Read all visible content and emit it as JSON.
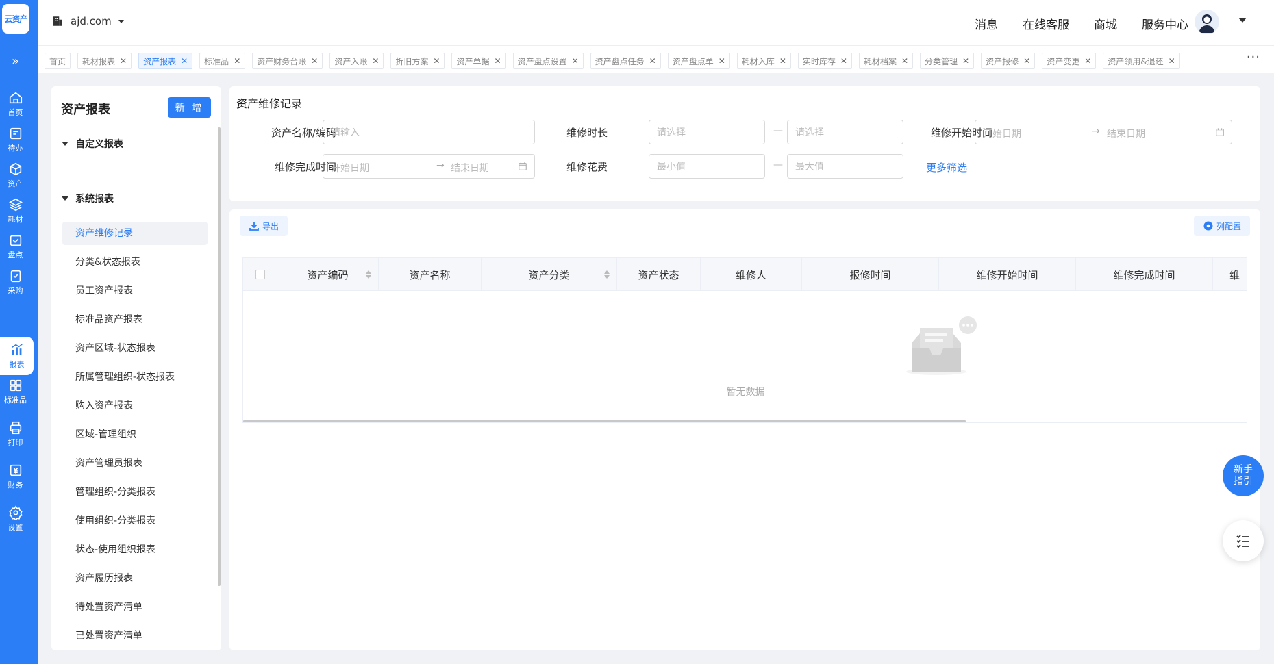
{
  "app": {
    "logo_text": "云资产"
  },
  "nav": {
    "items": [
      {
        "label": "首页",
        "icon": "home-icon"
      },
      {
        "label": "待办",
        "icon": "todo-icon"
      },
      {
        "label": "资产",
        "icon": "asset-box-icon"
      },
      {
        "label": "耗材",
        "icon": "layers-icon"
      },
      {
        "label": "盘点",
        "icon": "check-calendar-icon"
      },
      {
        "label": "采购",
        "icon": "clipboard-check-icon"
      },
      {
        "label": "报表",
        "icon": "report-chart-icon",
        "active": true
      },
      {
        "label": "标准品",
        "icon": "grid-icon"
      },
      {
        "label": "打印",
        "icon": "printer-icon"
      },
      {
        "label": "财务",
        "icon": "finance-icon"
      },
      {
        "label": "设置",
        "icon": "gear-icon"
      }
    ]
  },
  "header": {
    "domain": "ajd.com",
    "links": [
      "消息",
      "在线客服",
      "商城",
      "服务中心"
    ]
  },
  "tabs": [
    {
      "label": "首页",
      "closable": false
    },
    {
      "label": "耗材报表",
      "closable": true
    },
    {
      "label": "资产报表",
      "closable": true,
      "active": true
    },
    {
      "label": "标准品",
      "closable": true
    },
    {
      "label": "资产财务台账",
      "closable": true
    },
    {
      "label": "资产入账",
      "closable": true
    },
    {
      "label": "折旧方案",
      "closable": true
    },
    {
      "label": "资产单据",
      "closable": true
    },
    {
      "label": "资产盘点设置",
      "closable": true
    },
    {
      "label": "资产盘点任务",
      "closable": true
    },
    {
      "label": "资产盘点单",
      "closable": true
    },
    {
      "label": "耗材入库",
      "closable": true
    },
    {
      "label": "实时库存",
      "closable": true
    },
    {
      "label": "耗材档案",
      "closable": true
    },
    {
      "label": "分类管理",
      "closable": true
    },
    {
      "label": "资产报修",
      "closable": true
    },
    {
      "label": "资产变更",
      "closable": true
    },
    {
      "label": "资产领用&退还",
      "closable": true
    }
  ],
  "tab_more": "···",
  "report_panel": {
    "title": "资产报表",
    "new_button": "新 增",
    "group_custom": "自定义报表",
    "group_system": "系统报表",
    "items": [
      "资产维修记录",
      "分类&状态报表",
      "员工资产报表",
      "标准品资产报表",
      "资产区域-状态报表",
      "所属管理组织-状态报表",
      "购入资产报表",
      "区域-管理组织",
      "资产管理员报表",
      "管理组织-分类报表",
      "使用组织-分类报表",
      "状态-使用组织报表",
      "资产履历报表",
      "待处置资产清单",
      "已处置资产清单"
    ]
  },
  "filters": {
    "title": "资产维修记录",
    "name_label": "资产名称/编码",
    "name_placeholder": "请输入",
    "duration_label": "维修时长",
    "duration_from_placeholder": "请选择",
    "duration_to_placeholder": "请选择",
    "start_label": "维修开始时间",
    "finish_label": "维修完成时间",
    "date_start_placeholder": "开始日期",
    "date_end_placeholder": "结束日期",
    "cost_label": "维修花费",
    "cost_min_placeholder": "最小值",
    "cost_max_placeholder": "最大值",
    "dash": "—",
    "arrow": "→",
    "more": "更多筛选"
  },
  "table": {
    "export_label": "导出",
    "columns_label": "列配置",
    "columns": [
      "资产编码",
      "资产名称",
      "资产分类",
      "资产状态",
      "维修人",
      "报修时间",
      "维修开始时间",
      "维修完成时间",
      "维"
    ],
    "empty_text": "暂无数据"
  },
  "floating": {
    "guide": "新手\n指引"
  },
  "colors": {
    "primary": "#2b7ef5",
    "background": "#f0f2f5"
  }
}
